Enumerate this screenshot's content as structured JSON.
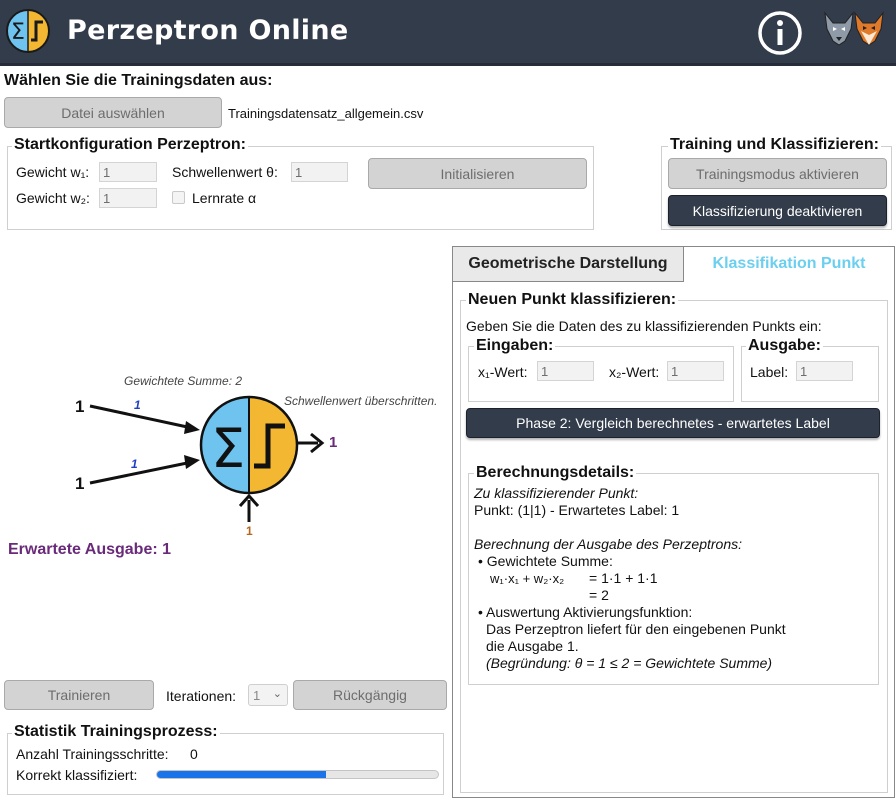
{
  "header": {
    "title": "Perzeptron Online",
    "logo_glyph": "Σ",
    "colors": {
      "bar": "#333c4a",
      "logo_left": "#6ec4ef",
      "logo_right": "#f3b731"
    }
  },
  "training_data": {
    "title": "Wählen Sie die Trainingsdaten aus:",
    "file_button": "Datei auswählen",
    "file_name": "Trainingsdatensatz_allgemein.csv"
  },
  "start_config": {
    "title": "Startkonfiguration Perzeptron:",
    "weight1_label": "Gewicht w₁:",
    "weight1_value": "1",
    "weight2_label": "Gewicht w₂:",
    "weight2_value": "1",
    "threshold_label": "Schwellenwert θ:",
    "threshold_value": "1",
    "learning_rate_label": "Lernrate α",
    "init_button": "Initialisieren"
  },
  "training_classify": {
    "title": "Training und Klassifizieren:",
    "training_button": "Trainingsmodus aktivieren",
    "classify_button": "Klassifizierung deaktivieren"
  },
  "perceptron": {
    "weighted_sum_text": "Gewichtete Summe: 2",
    "threshold_text": "Schwellenwert überschritten.",
    "input1": "1",
    "input2": "1",
    "weight1": "1",
    "weight2": "1",
    "bias_value": "1",
    "output": "1",
    "expected_output": "Erwartete Ausgabe: 1",
    "colors": {
      "left": "#6ec4ef",
      "right": "#f3b731",
      "purple": "#6a2a7a",
      "blue": "#1f3fc2",
      "bias": "#b5651d"
    }
  },
  "controls": {
    "train_button": "Trainieren",
    "iterations_label": "Iterationen:",
    "iterations_value": "1",
    "undo_button": "Rückgängig"
  },
  "statistics": {
    "title": "Statistik Trainingsprozess:",
    "steps_label": "Anzahl Trainingsschritte:",
    "steps_value": "0",
    "correct_label": "Korrekt klassifiziert:",
    "correct_fraction": 0.6
  },
  "tabs": {
    "geometric": "Geometrische Darstellung",
    "classify": "Klassifikation Punkt"
  },
  "classify_panel": {
    "title": "Neuen Punkt klassifizieren:",
    "instruction": "Geben Sie die Daten des zu klassifizierenden Punkts ein:",
    "inputs_title": "Eingaben:",
    "x1_label": "x₁-Wert:",
    "x1_value": "1",
    "x2_label": "x₂-Wert:",
    "x2_value": "1",
    "output_title": "Ausgabe:",
    "label_label": "Label:",
    "label_value": "1",
    "phase_button": "Phase 2: Vergleich berechnetes - erwartetes Label"
  },
  "details": {
    "title": "Berechnungsdetails:",
    "point_heading": "Zu klassifizierender Punkt:",
    "point_line": "Punkt: (1|1) -  Erwartetes Label: 1",
    "calc_heading": "Berechnung der Ausgabe des Perzeptrons:",
    "sum_bullet": "• Gewichtete Summe:",
    "sum_formula": "w₁·x₁ + w₂·x₂",
    "sum_eq1": "= 1·1 + 1·1",
    "sum_eq2": "= 2",
    "act_bullet": "• Auswertung Aktivierungsfunktion:",
    "act_line1": "Das Perzeptron liefert für den eingebenen Punkt",
    "act_line2": "die Ausgabe 1.",
    "act_reason": "(Begründung: θ = 1 ≤ 2 = Gewichtete Summe)"
  }
}
